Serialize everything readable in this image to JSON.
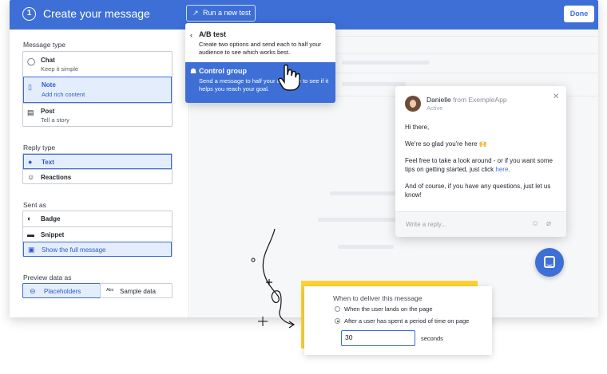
{
  "header": {
    "step_number": "1",
    "title": "Create your message",
    "run_test_label": "Run a new test",
    "done_label": "Done"
  },
  "sidebar": {
    "message_type_label": "Message type",
    "message_types": [
      {
        "title": "Chat",
        "subtitle": "Keep it simple",
        "icon": "chat-bubble-icon",
        "selected": false
      },
      {
        "title": "Note",
        "subtitle": "Add rich content",
        "icon": "note-icon",
        "selected": true
      },
      {
        "title": "Post",
        "subtitle": "Tell a story",
        "icon": "post-icon",
        "selected": false
      }
    ],
    "reply_type_label": "Reply type",
    "reply_types": [
      {
        "title": "Text",
        "icon": "text-reply-icon",
        "selected": true
      },
      {
        "title": "Reactions",
        "icon": "smiley-icon",
        "selected": false
      }
    ],
    "sent_as_label": "Sent as",
    "sent_as": [
      {
        "title": "Badge",
        "icon": "badge-icon",
        "selected": false
      },
      {
        "title": "Snippet",
        "icon": "snippet-icon",
        "selected": false
      },
      {
        "title": "Show the full message",
        "icon": "full-message-icon",
        "selected": true
      }
    ],
    "preview_label": "Preview data as",
    "preview": [
      {
        "title": "Placeholders",
        "icon": "placeholder-icon",
        "selected": true
      },
      {
        "title": "Sample data",
        "icon": "abc-icon",
        "selected": false
      }
    ]
  },
  "dropdown": {
    "ab_title": "A/B test",
    "ab_desc": "Create two options and send each to half your audience to see which works best.",
    "cg_title": "Control group",
    "cg_desc": "Send a message to half your audience to see if it helps you reach your goal."
  },
  "messenger": {
    "sender_name": "Danielle",
    "sender_from": "from ExempleApp",
    "status": "Active",
    "greeting": "Hi there,",
    "line2": "We're so glad you're here 🙌",
    "line3_pre": "Feel free to take a look around - or if you want some tips on getting started, just click ",
    "line3_link": "here",
    "line3_post": ".",
    "line4": "And of course, if you have any questions, just let us know!",
    "reply_placeholder": "Write a reply..."
  },
  "deliver": {
    "title": "When to deliver this message",
    "option1": "When the user lands on the page",
    "option2": "After a user has spent a period of time on page",
    "selected_option": 2,
    "seconds_value": "30",
    "seconds_label": "seconds"
  },
  "colors": {
    "accent": "#3d6fd6",
    "highlight": "#ffd335",
    "selected_bg": "#e4edfc"
  }
}
